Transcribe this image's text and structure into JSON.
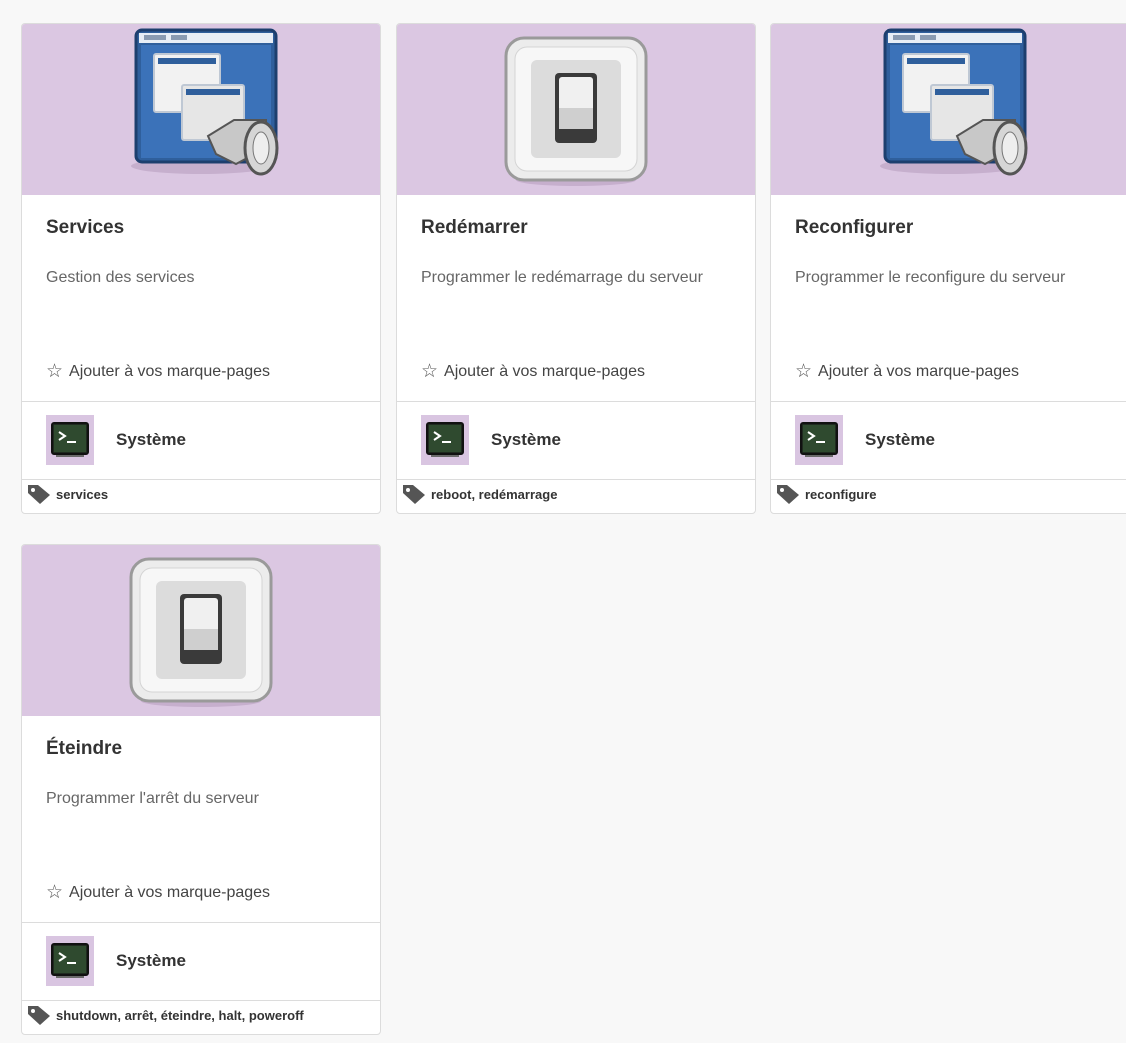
{
  "colors": {
    "banner": "#dbc7e2",
    "card_border": "#dcdcdc",
    "page_bg": "#f8f8f8"
  },
  "cards": [
    {
      "title": "Services",
      "description": "Gestion des services",
      "bookmark_label": "Ajouter à vos marque-pages",
      "category_label": "Système",
      "tags": "services",
      "icon": "window-services-icon"
    },
    {
      "title": "Redémarrer",
      "description": "Programmer le redémarrage du serveur",
      "bookmark_label": "Ajouter à vos marque-pages",
      "category_label": "Système",
      "tags": "reboot, redémarrage",
      "icon": "switch-icon"
    },
    {
      "title": "Reconfigurer",
      "description": "Programmer le reconfigure du serveur",
      "bookmark_label": "Ajouter à vos marque-pages",
      "category_label": "Système",
      "tags": "reconfigure",
      "icon": "window-services-icon"
    },
    {
      "title": "Éteindre",
      "description": "Programmer l'arrêt du serveur",
      "bookmark_label": "Ajouter à vos marque-pages",
      "category_label": "Système",
      "tags": "shutdown, arrêt, éteindre, halt, poweroff",
      "icon": "switch-icon"
    }
  ]
}
